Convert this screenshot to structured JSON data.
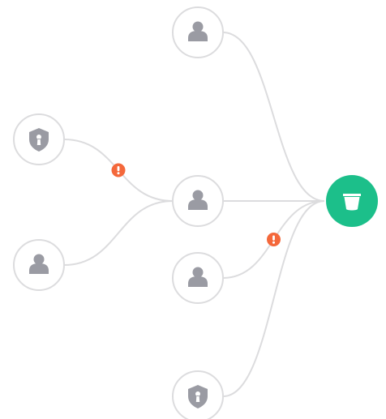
{
  "graph": {
    "colors": {
      "edge": "#dcdcde",
      "node_border": "#dcdcde",
      "node_icon": "#9a9ba3",
      "target_fill": "#1cbf8a",
      "warning_fill": "#f4683b"
    },
    "target": {
      "icon": "bucket-icon"
    },
    "nodes": [
      {
        "id": "user-top",
        "icon": "user-icon"
      },
      {
        "id": "shield-left",
        "icon": "shield-keyhole-icon"
      },
      {
        "id": "user-left",
        "icon": "user-icon"
      },
      {
        "id": "user-hub",
        "icon": "user-icon"
      },
      {
        "id": "user-lower",
        "icon": "user-icon"
      },
      {
        "id": "shield-bottom",
        "icon": "shield-keyhole-icon"
      }
    ],
    "edges": [
      {
        "from": "user-top",
        "to": "target",
        "warning": false
      },
      {
        "from": "user-hub",
        "to": "target",
        "warning": false
      },
      {
        "from": "user-lower",
        "to": "target",
        "warning": true
      },
      {
        "from": "shield-bottom",
        "to": "target",
        "warning": false
      },
      {
        "from": "shield-left",
        "to": "user-hub",
        "warning": true
      },
      {
        "from": "user-left",
        "to": "user-hub",
        "warning": false
      }
    ]
  }
}
